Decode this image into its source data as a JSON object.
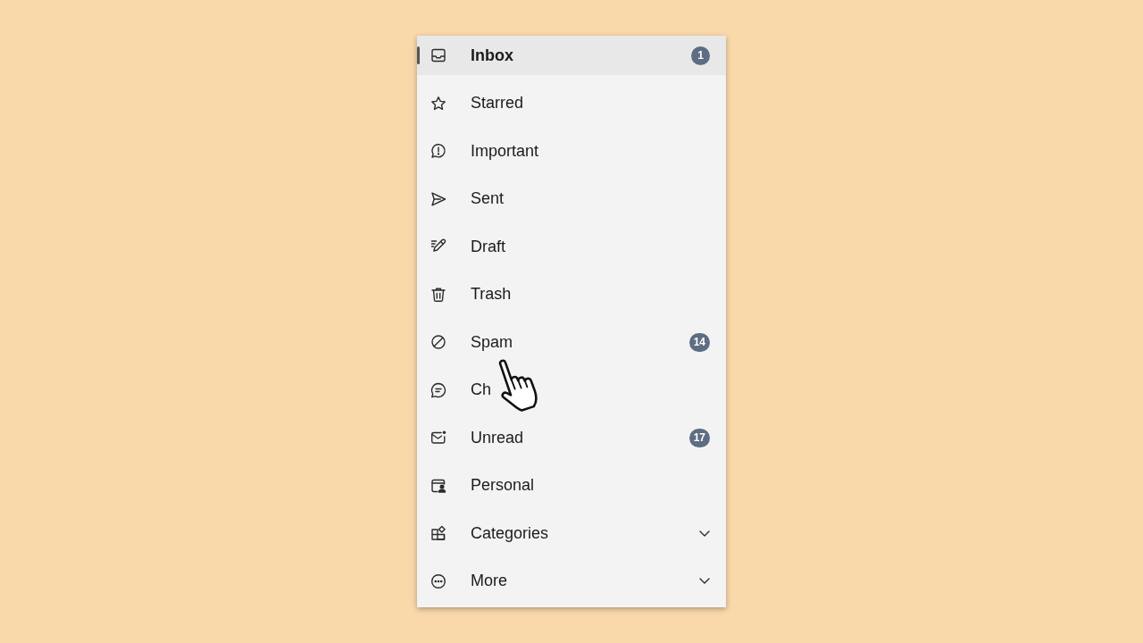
{
  "sidebar": {
    "items": [
      {
        "label": "Inbox",
        "selected": true,
        "badge": "1"
      },
      {
        "label": "Starred",
        "selected": false
      },
      {
        "label": "Important",
        "selected": false
      },
      {
        "label": "Sent",
        "selected": false
      },
      {
        "label": "Draft",
        "selected": false
      },
      {
        "label": "Trash",
        "selected": false
      },
      {
        "label": "Spam",
        "selected": false,
        "badge": "14"
      },
      {
        "label": "Ch",
        "selected": false
      },
      {
        "label": "Unread",
        "selected": false,
        "badge": "17"
      },
      {
        "label": "Personal",
        "selected": false
      },
      {
        "label": "Categories",
        "selected": false,
        "expanded": false
      },
      {
        "label": "More",
        "selected": false,
        "expanded": false
      }
    ]
  }
}
